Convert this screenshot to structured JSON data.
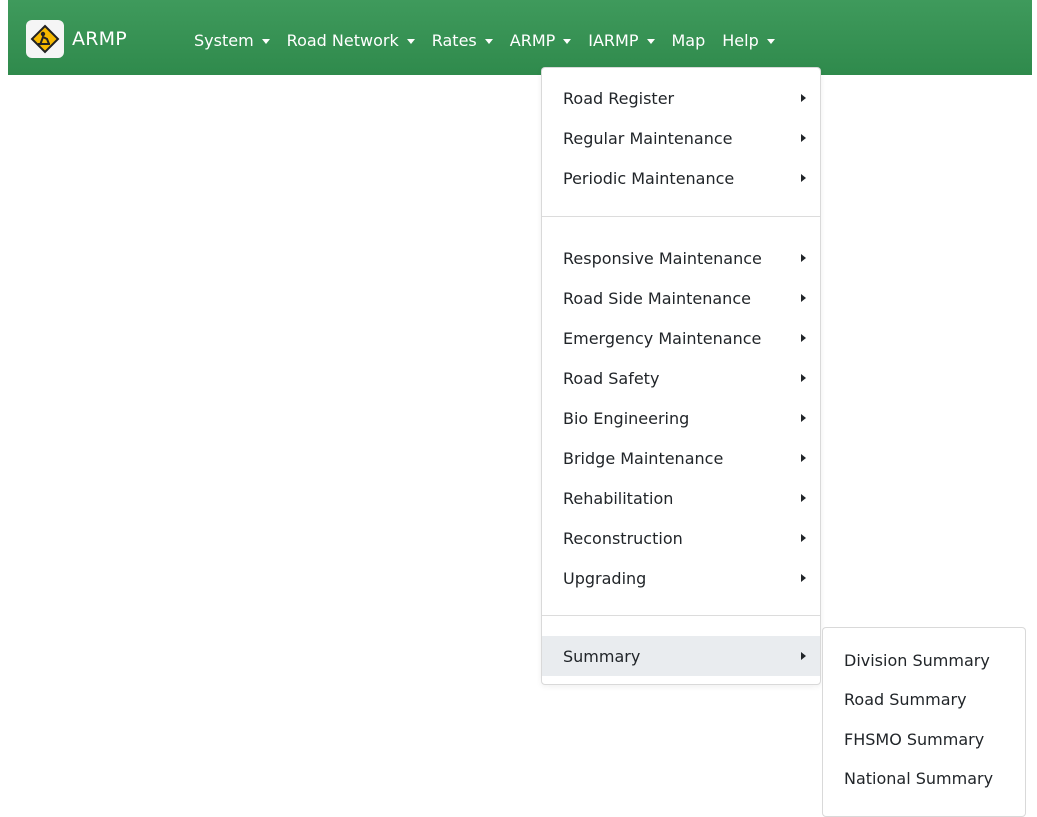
{
  "navbar": {
    "brand": "ARMP",
    "brand_icon": "road-work-sign-icon",
    "bg_color": "#2f8a4c",
    "items": [
      {
        "label": "System",
        "dropdown": true
      },
      {
        "label": "Road Network",
        "dropdown": true
      },
      {
        "label": "Rates",
        "dropdown": true
      },
      {
        "label": "ARMP",
        "dropdown": true
      },
      {
        "label": "IARMP",
        "dropdown": true
      },
      {
        "label": "Map",
        "dropdown": false
      },
      {
        "label": "Help",
        "dropdown": true
      }
    ]
  },
  "armp_menu": {
    "group1": [
      {
        "label": "Road Register"
      },
      {
        "label": "Regular Maintenance"
      },
      {
        "label": "Periodic Maintenance"
      }
    ],
    "group2": [
      {
        "label": "Responsive Maintenance"
      },
      {
        "label": "Road Side Maintenance"
      },
      {
        "label": "Emergency Maintenance"
      },
      {
        "label": "Road Safety"
      },
      {
        "label": "Bio Engineering"
      },
      {
        "label": "Bridge Maintenance"
      },
      {
        "label": "Rehabilitation"
      },
      {
        "label": "Reconstruction"
      },
      {
        "label": "Upgrading"
      }
    ],
    "group3": [
      {
        "label": "Summary",
        "active": true
      }
    ]
  },
  "summary_submenu": {
    "items": [
      {
        "label": "Division Summary"
      },
      {
        "label": "Road Summary"
      },
      {
        "label": "FHSMO Summary"
      },
      {
        "label": "National Summary"
      }
    ]
  }
}
